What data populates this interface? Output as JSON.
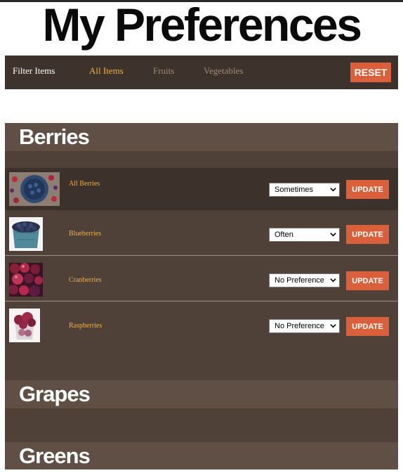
{
  "page": {
    "title": "My Preferences"
  },
  "filter": {
    "label": "Filter Items",
    "links": [
      {
        "label": "All Items",
        "color": "#f0b13d",
        "active": true
      },
      {
        "label": "Fruits",
        "color": "#a08a72",
        "active": false
      },
      {
        "label": "Vegetables",
        "color": "#a08a72",
        "active": false
      }
    ],
    "reset_label": "RESET"
  },
  "sections": [
    {
      "title": "Berries",
      "items": [
        {
          "label": "All Berries",
          "preference": "Sometimes",
          "update_label": "UPDATE",
          "image": "mixed-berries-bowl"
        },
        {
          "label": "Blueberries",
          "preference": "Often",
          "update_label": "UPDATE",
          "image": "blueberries-carton"
        },
        {
          "label": "Cranberries",
          "preference": "No Preference",
          "update_label": "UPDATE",
          "image": "cranberries"
        },
        {
          "label": "Raspberries",
          "preference": "No Preference",
          "update_label": "UPDATE",
          "image": "raspberries-cup"
        }
      ]
    },
    {
      "title": "Grapes",
      "items": []
    },
    {
      "title": "Greens",
      "items": []
    }
  ],
  "colors": {
    "accent": "#d9603b",
    "link": "#f0b13d",
    "panel": "#4f4138",
    "header": "#5f4f44",
    "bar": "#3e322c"
  }
}
